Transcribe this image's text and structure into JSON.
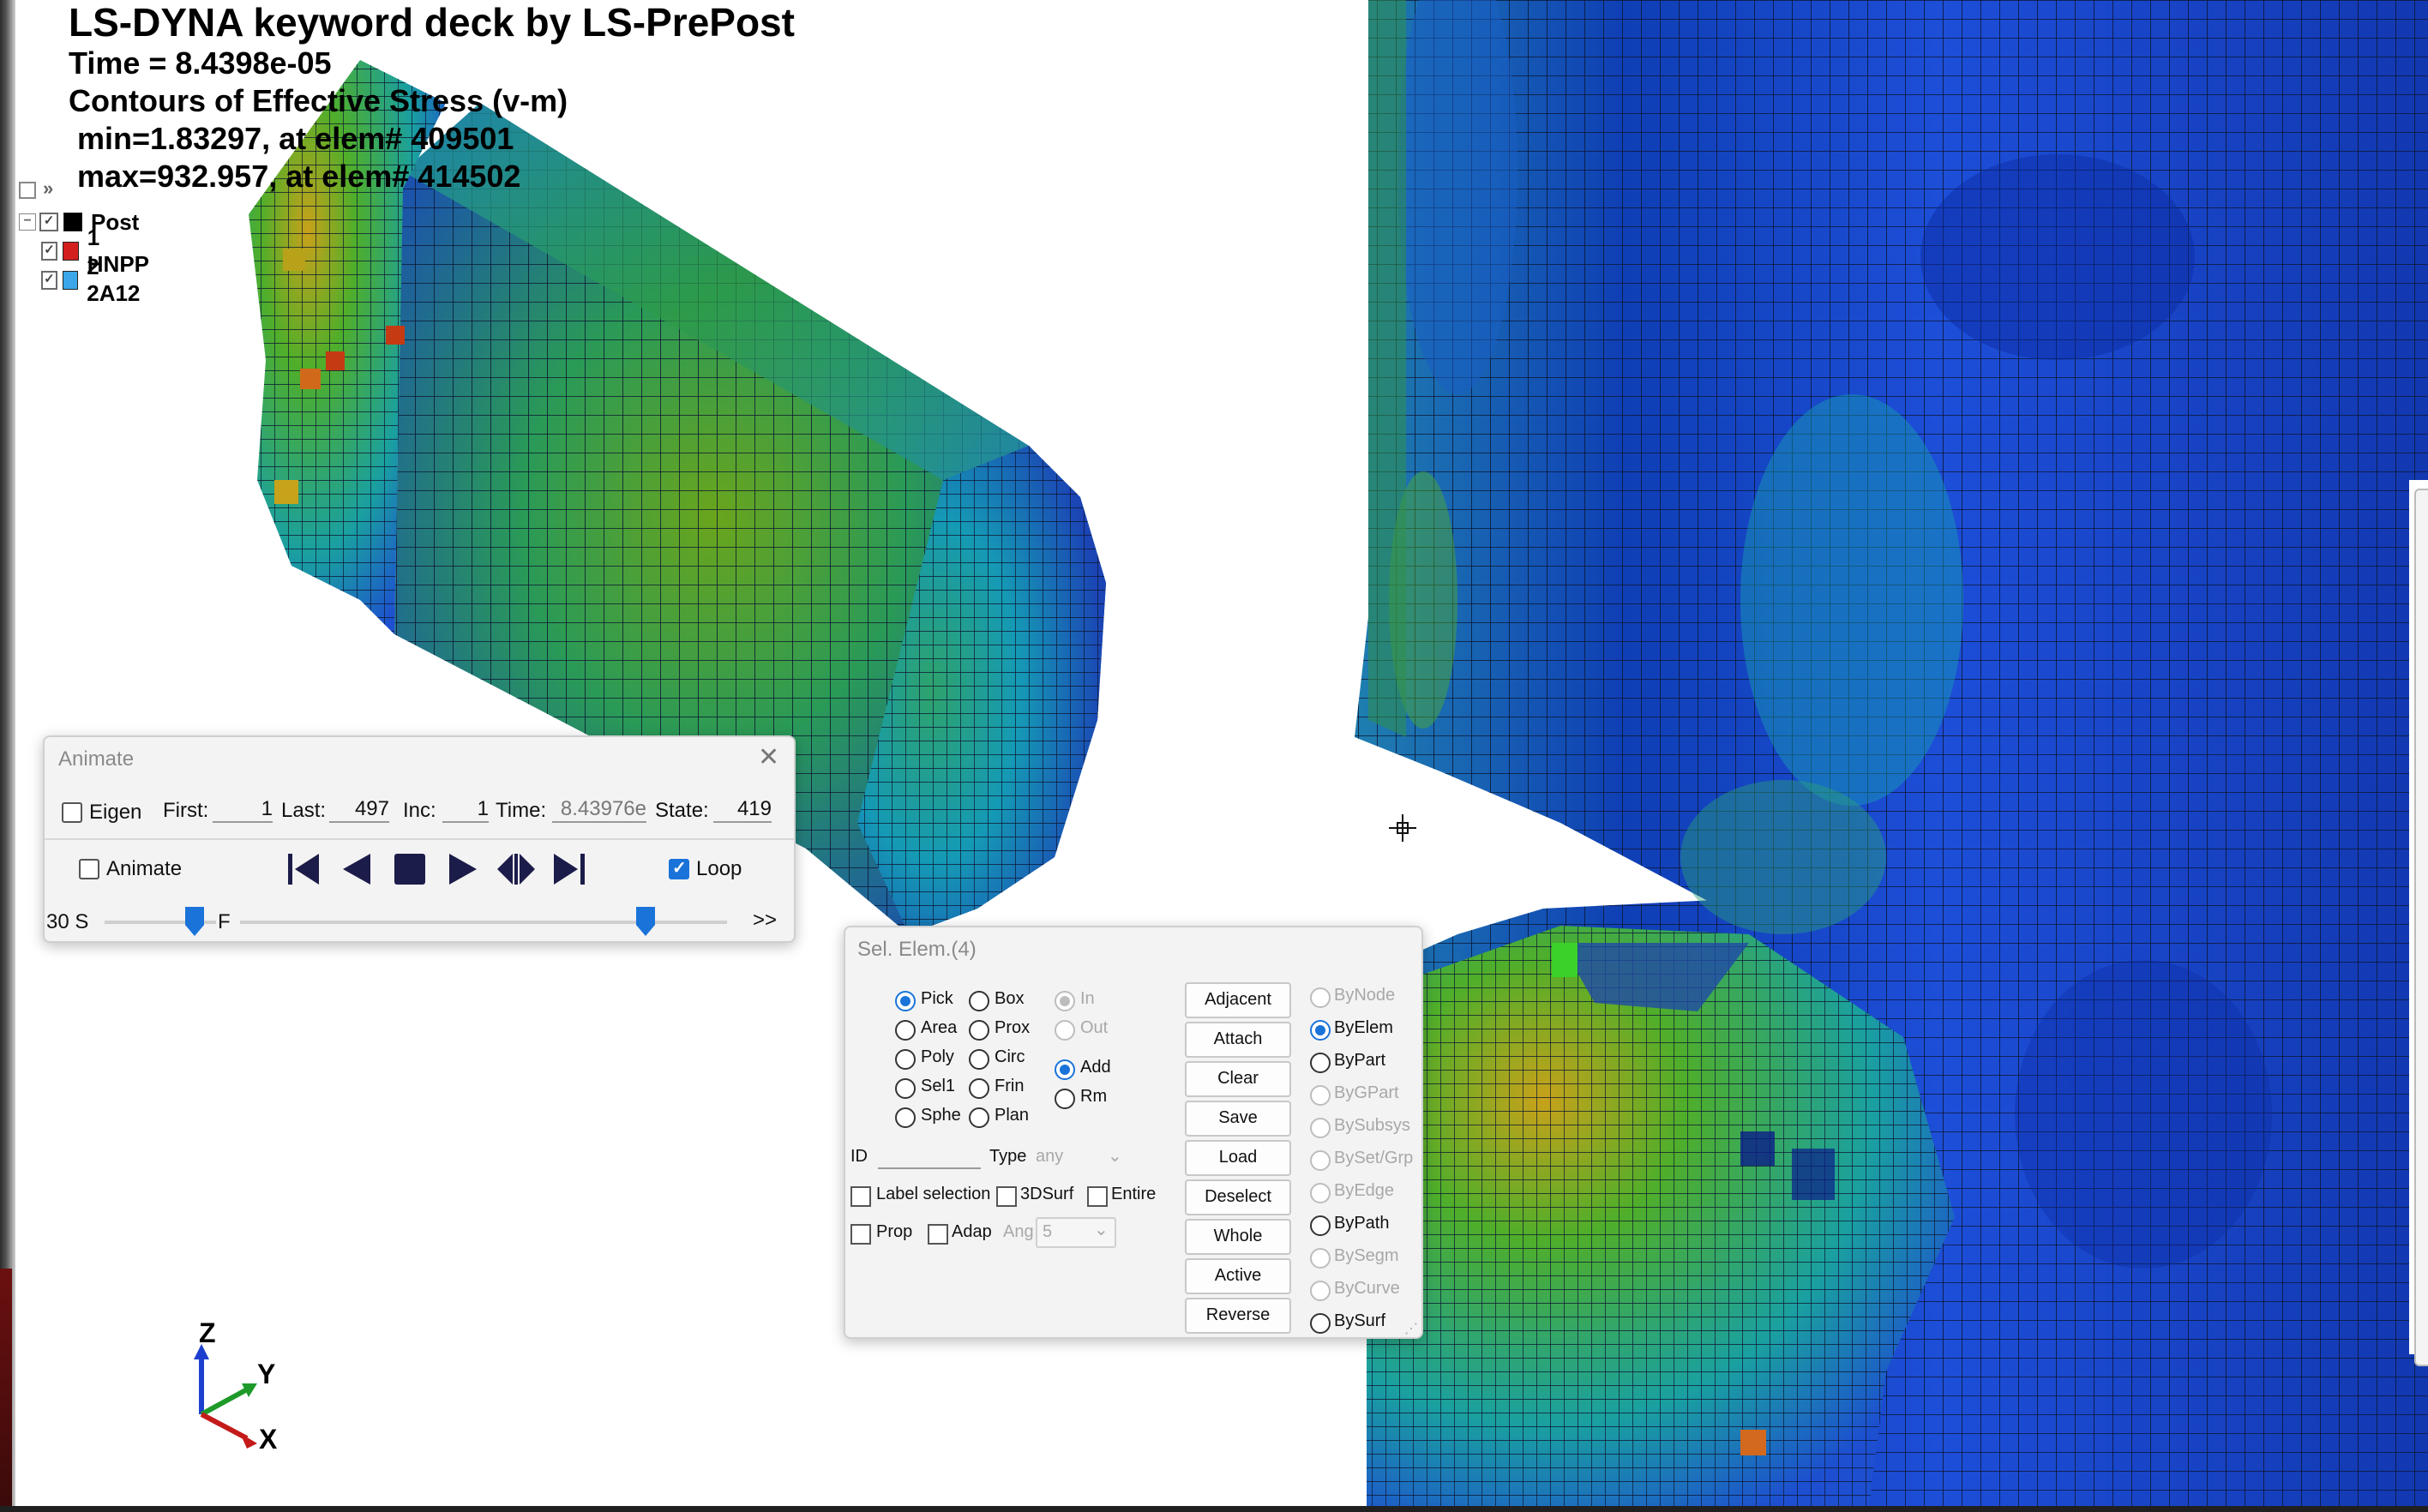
{
  "viewer": {
    "title": "LS-DYNA keyword deck by LS-PrePost",
    "time_line": "Time =  8.4398e-05",
    "contour_line": "Contours of Effective Stress (v-m)",
    "min_line": " min=1.83297, at elem# 409501",
    "max_line": " max=932.957, at elem# 414502"
  },
  "part_tree": {
    "root": {
      "label": "Post",
      "color": "#000000"
    },
    "parts": [
      {
        "label": "1 HNPP",
        "color": "#d41f1f"
      },
      {
        "label": "2 2A12",
        "color": "#3ba7e8"
      }
    ]
  },
  "triad": {
    "z": "Z",
    "y": "Y",
    "x": "X"
  },
  "animate_panel": {
    "title": "Animate",
    "eigen_label": "Eigen",
    "first_label": "First:",
    "first_value": "1",
    "last_label": "Last:",
    "last_value": "497",
    "inc_label": "Inc:",
    "inc_value": "1",
    "time_label": "Time:",
    "time_value": "8.43976e",
    "state_label": "State:",
    "state_value": "419",
    "animate_label": "Animate",
    "loop_label": "Loop",
    "loop_checked": true,
    "speed_slow": "30 S",
    "speed_fast": "F",
    "more": ">>"
  },
  "sel_panel": {
    "title": "Sel. Elem.(4)",
    "methods_col1": [
      "Pick",
      "Area",
      "Poly",
      "Sel1",
      "Sphe"
    ],
    "methods_col2": [
      "Box",
      "Prox",
      "Circ",
      "Frin",
      "Plan"
    ],
    "selected_method": "Pick",
    "inout": [
      "In",
      "Out"
    ],
    "addrm": [
      "Add",
      "Rm"
    ],
    "selected_mode": "Add",
    "buttons": [
      "Adjacent",
      "Attach",
      "Clear",
      "Save",
      "Load",
      "Deselect",
      "Whole",
      "Active",
      "Reverse"
    ],
    "by_options": [
      "ByNode",
      "ByElem",
      "ByPart",
      "ByGPart",
      "BySubsys",
      "BySet/Grp",
      "ByEdge",
      "ByPath",
      "BySegm",
      "ByCurve",
      "BySurf"
    ],
    "selected_by": "ByElem",
    "id_label": "ID",
    "type_label": "Type",
    "type_value": "any",
    "label_selection": "Label selection",
    "surf3d": "3DSurf",
    "entire": "Entire",
    "prop": "Prop",
    "adap": "Adap",
    "ang_label": "Ang",
    "ang_value": "5"
  }
}
